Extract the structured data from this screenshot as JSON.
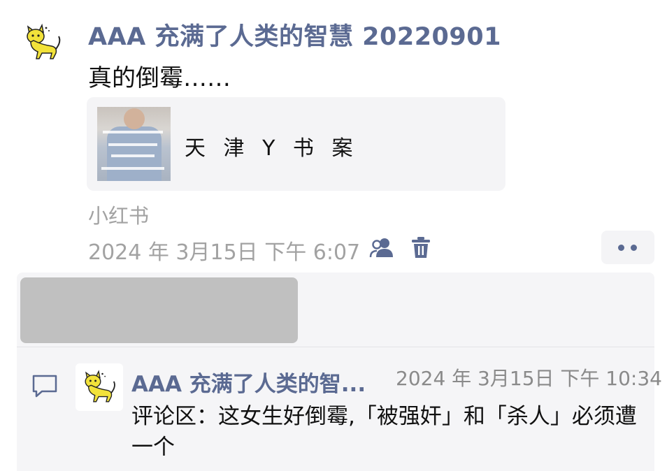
{
  "post": {
    "author": "AAA 充满了人类的智慧 20220901",
    "text": "真的倒霉……",
    "link_card": {
      "title": "天 津 Y 书 案",
      "thumbnail_icon": "video-thumbnail"
    },
    "source": "小红书",
    "timestamp": "2024 年 3月15日 下午 6:07",
    "actions": {
      "friends_icon": "friends-icon",
      "delete_icon": "trash-icon",
      "more_icon": "more-dots-icon"
    }
  },
  "comments": [
    {
      "author": "AAA 充满了人类的智...",
      "time": "2024 年 3月15日 下午 10:34",
      "text": "评论区：这女生好倒霉,「被强奸」和「杀人」必须遭一个"
    }
  ],
  "colors": {
    "name_blue": "#5b6a92",
    "meta_gray": "#a2a2a2",
    "panel_bg": "#f5f5f7",
    "redacted_gray": "#c0c0c0"
  }
}
